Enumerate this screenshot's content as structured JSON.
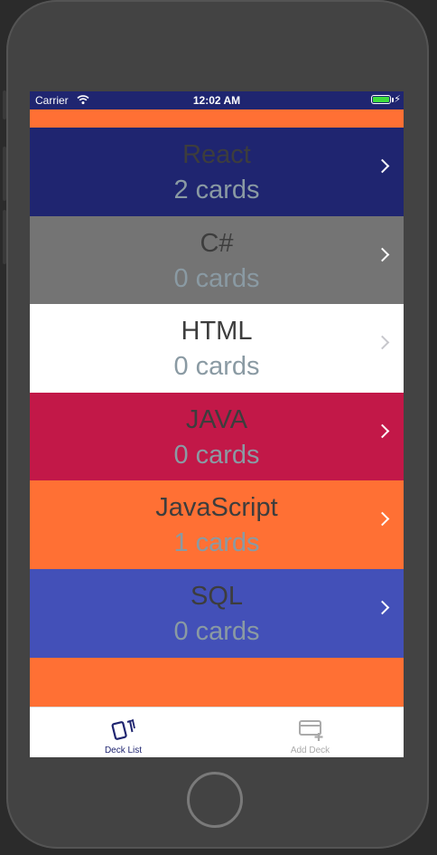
{
  "status_bar": {
    "carrier": "Carrier",
    "time": "12:02 AM",
    "wifi_icon": "wifi-icon",
    "battery_icon": "battery-charging-icon",
    "battery_level": 1.0
  },
  "colors": {
    "status_bar": "#1f2570",
    "accent_orange": "#ff7034",
    "tab_active": "#1f2570",
    "tab_inactive": "#aaaaaa"
  },
  "decks": [
    {
      "title": "React",
      "count": "2 cards",
      "bg": "#1f2570"
    },
    {
      "title": "C#",
      "count": "0 cards",
      "bg": "#747474"
    },
    {
      "title": "HTML",
      "count": "0 cards",
      "bg": "#ffffff"
    },
    {
      "title": "JAVA",
      "count": "0 cards",
      "bg": "#c21848"
    },
    {
      "title": "JavaScript",
      "count": "1 cards",
      "bg": "#ff7034"
    },
    {
      "title": "SQL",
      "count": "0 cards",
      "bg": "#4350b8"
    }
  ],
  "tabs": [
    {
      "label": "Deck List",
      "icon": "cards-icon",
      "active": true
    },
    {
      "label": "Add Deck",
      "icon": "add-card-icon",
      "active": false
    }
  ]
}
